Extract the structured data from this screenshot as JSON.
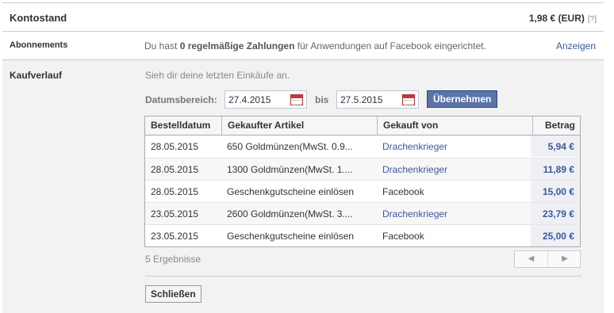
{
  "konto": {
    "label": "Kontostand",
    "amount": "1,98 € (EUR)",
    "help": "[?]"
  },
  "abo": {
    "label": "Abonnements",
    "text_before": "Du hast ",
    "text_bold": "0 regelmäßige Zahlungen",
    "text_after": " für Anwendungen auf Facebook eingerichtet.",
    "link": "Anzeigen"
  },
  "kauf": {
    "label": "Kaufverlauf",
    "intro": "Sieh dir deine letzten Einkäufe an.",
    "date_label": "Datumsbereich:",
    "date_from": "27.4.2015",
    "bis": "bis",
    "date_to": "27.5.2015",
    "apply": "Übernehmen",
    "columns": [
      "Bestelldatum",
      "Gekaufter Artikel",
      "Gekauft von",
      "Betrag"
    ],
    "rows": [
      {
        "date": "28.05.2015",
        "item": "650 Goldmünzen(MwSt. 0.9...",
        "seller": "Drachenkrieger",
        "amount": "5,94 €"
      },
      {
        "date": "28.05.2015",
        "item": "1300 Goldmünzen(MwSt. 1....",
        "seller": "Drachenkrieger",
        "amount": "11,89 €"
      },
      {
        "date": "28.05.2015",
        "item": "Geschenkgutscheine einlösen",
        "seller": "Facebook",
        "amount": "15,00 €"
      },
      {
        "date": "23.05.2015",
        "item": "2600 Goldmünzen(MwSt. 3....",
        "seller": "Drachenkrieger",
        "amount": "23,79 €"
      },
      {
        "date": "23.05.2015",
        "item": "Geschenkgutscheine einlösen",
        "seller": "Facebook",
        "amount": "25,00 €"
      }
    ],
    "result_count": "5 Ergebnisse",
    "pager_prev": "◀",
    "pager_next": "▶",
    "close": "Schließen"
  }
}
